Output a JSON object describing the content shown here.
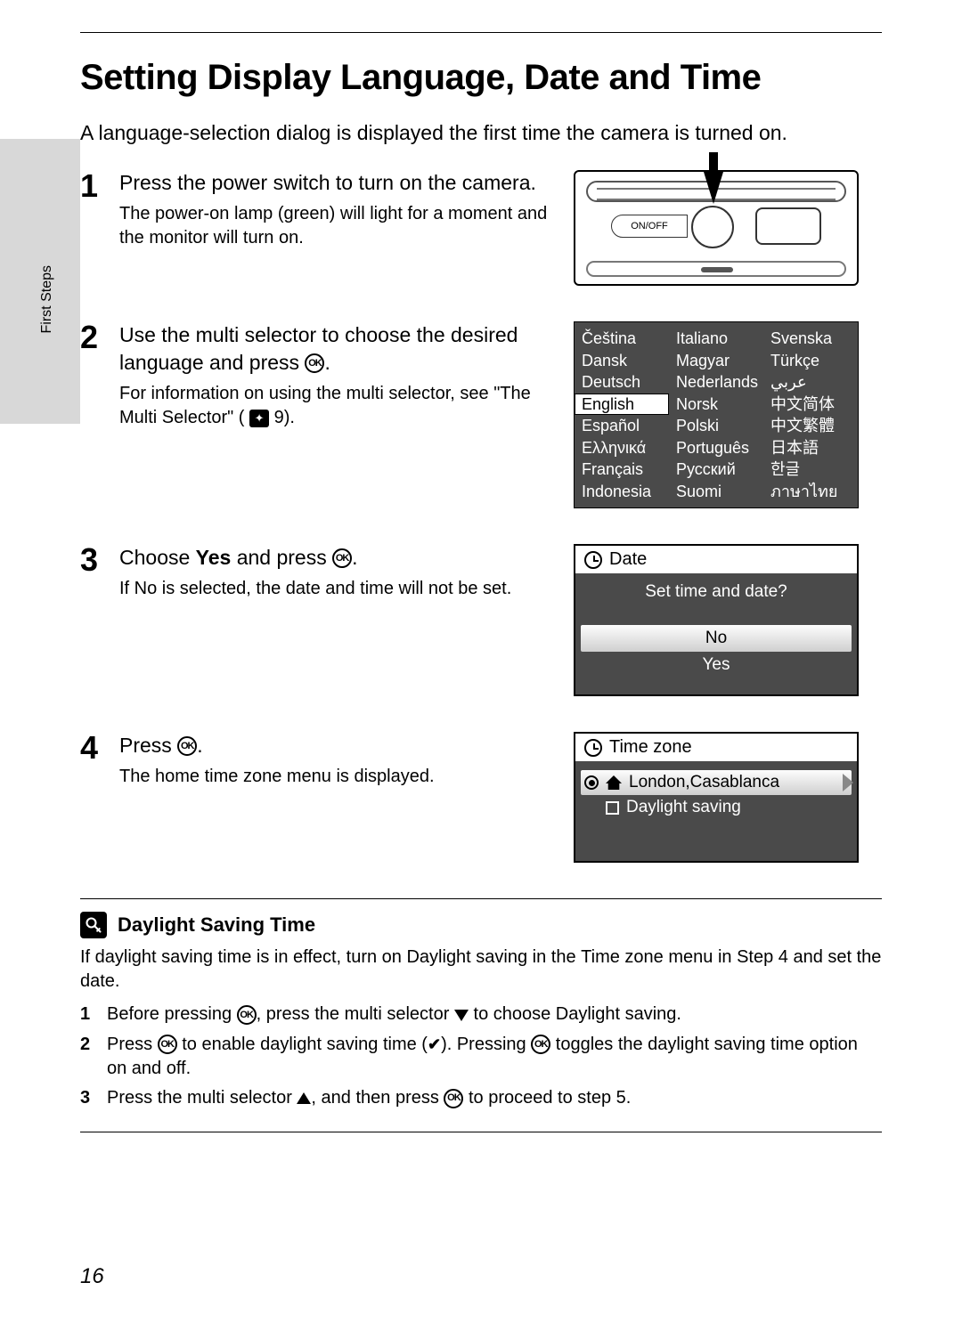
{
  "page_number": "16",
  "side_tab": "First Steps",
  "heading": "Setting Display Language, Date and Time",
  "intro": "A language-selection dialog is displayed the first time the camera is turned on.",
  "camera": {
    "onoff_label": "ON/OFF"
  },
  "steps": {
    "s1": {
      "num": "1",
      "title": "Press the power switch to turn on the camera.",
      "text": "The power-on lamp (green) will light for a moment and the monitor will turn on."
    },
    "s2": {
      "num": "2",
      "title_a": "Use the multi selector to choose the desired language and press ",
      "title_b": ".",
      "text_a": "For information on using the multi selector, see \"The Multi Selector\" (",
      "text_b": " 9)."
    },
    "s3": {
      "num": "3",
      "title_a": "Choose ",
      "title_bold": "Yes",
      "title_b": " and press ",
      "title_c": ".",
      "text_a": "If ",
      "text_bold": "No",
      "text_b": " is selected, the date and time will not be set."
    },
    "s4": {
      "num": "4",
      "title_a": "Press ",
      "title_b": ".",
      "text": "The home time zone menu is displayed."
    }
  },
  "languages": [
    "Čeština",
    "Italiano",
    "Svenska",
    "Dansk",
    "Magyar",
    "Türkçe",
    "Deutsch",
    "Nederlands",
    "عربي",
    "English",
    "Norsk",
    "中文简体",
    "Español",
    "Polski",
    "中文繁體",
    "Ελληνικά",
    "Português",
    "日本語",
    "Français",
    "Русский",
    "한글",
    "Indonesia",
    "Suomi",
    "ภาษาไทย"
  ],
  "lang_selected_index": 9,
  "date_dialog": {
    "title": "Date",
    "question": "Set time and date?",
    "opt_no": "No",
    "opt_yes": "Yes"
  },
  "tz_dialog": {
    "title": "Time zone",
    "home": "London,Casablanca",
    "daylight": "Daylight saving"
  },
  "note": {
    "title": "Daylight Saving Time",
    "body_a": "If daylight saving time is in effect, turn on ",
    "body_b1": "Daylight saving",
    "body_c": " in the ",
    "body_b2": "Time zone",
    "body_d": " menu in Step 4 and set the date.",
    "li1_a": "Before pressing ",
    "li1_b": ", press the multi selector ",
    "li1_c": " to choose ",
    "li1_bold": "Daylight saving",
    "li1_d": ".",
    "li2_a": "Press ",
    "li2_b": " to enable daylight saving time (",
    "li2_c": "). Pressing ",
    "li2_d": " toggles the daylight saving time option on and off.",
    "li3_a": "Press the multi selector ",
    "li3_b": ", and then press ",
    "li3_c": " to proceed to step 5.",
    "n1": "1",
    "n2": "2",
    "n3": "3"
  }
}
